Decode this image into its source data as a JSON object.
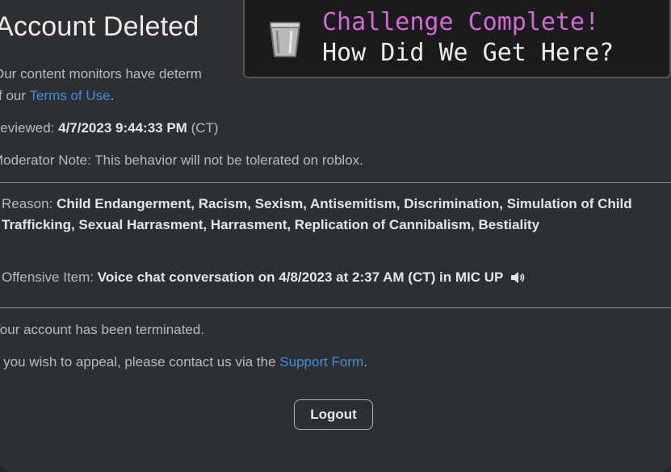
{
  "account": {
    "title": "Account Deleted",
    "intro_prefix": "Our content monitors have determ",
    "intro_line2_prefix": "f our",
    "terms_link": "Terms of Use",
    "intro_line2_suffix": ".",
    "reviewed_label": "Reviewed:",
    "reviewed_value": "4/7/2023 9:44:33 PM",
    "reviewed_tz": "(CT)",
    "moderator_note": "Moderator Note: This behavior will not be tolerated on roblox.",
    "reason_label": "Reason:",
    "reason_value": "Child Endangerment, Racism, Sexism, Antisemitism, Discrimination, Simulation of Child Trafficking, Sexual Harrasment, Harrasment, Replication of Cannibalism, Bestiality",
    "offensive_label": "Offensive Item:",
    "offensive_value": "Voice chat conversation on 4/8/2023 at 2:37 AM (CT) in MIC UP",
    "terminated_text": "Your account has been terminated.",
    "appeal_prefix": "If you wish to appeal, please contact us via the",
    "support_link": "Support Form",
    "appeal_suffix": ".",
    "logout_label": "Logout"
  },
  "toast": {
    "title": "Challenge Complete!",
    "subtitle": "How Did We Get Here?",
    "icon": "bucket-icon",
    "title_color": "#d468d8"
  },
  "colors": {
    "background": "#2d2f31",
    "link": "#3d8fe0"
  }
}
